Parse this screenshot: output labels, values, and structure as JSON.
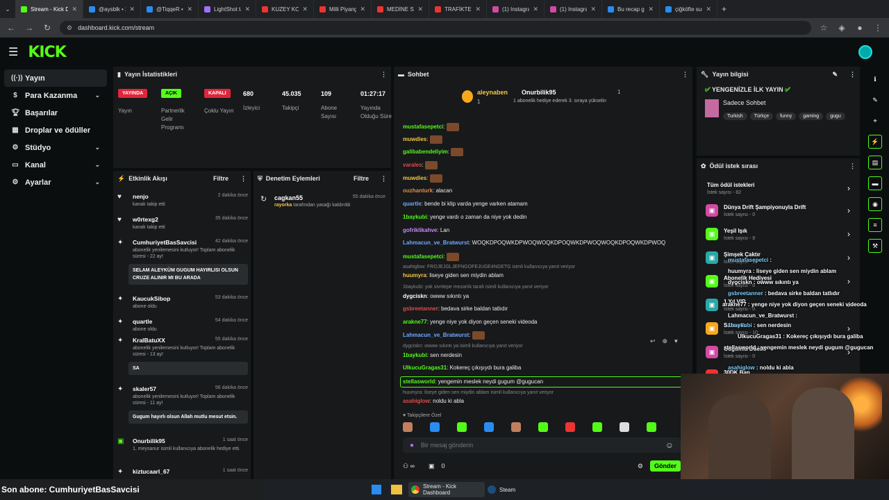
{
  "browser": {
    "tabs": [
      "Stream - Kick D",
      "@aysblk • 20",
      "@TiqqeR • 20",
      "LightShot tara",
      "KUZEY KORE'Y",
      "Milli Piyango",
      "MEDİNE SAYA",
      "TRAFİKTE TEH",
      "(1) Instagram",
      "(1) Instagram",
      "Bu recap gizli",
      "çiğköfte sushi"
    ],
    "url": "dashboard.kick.com/stream"
  },
  "header": {
    "logo": "KICK"
  },
  "sidebar": {
    "items": [
      "Yayın",
      "Para Kazanma",
      "Başarılar",
      "Droplar ve ödüller",
      "Stüdyo",
      "Kanal",
      "Ayarlar"
    ]
  },
  "stats": {
    "title": "Yayın İstatistikleri",
    "badges": [
      {
        "badge": "YAYINDA",
        "label": "Yayın"
      },
      {
        "badge": "AÇIK",
        "label": "Partnerlik Gelir Programı"
      },
      {
        "badge": "KAPALI",
        "label": "Çoklu Yayın"
      }
    ],
    "numbers": [
      {
        "value": "680",
        "label": "İzleyici"
      },
      {
        "value": "45.035",
        "label": "Takipçi"
      },
      {
        "value": "109",
        "label": "Abone Sayısı"
      },
      {
        "value": "01:27:17",
        "label": "Yayında Olduğu Süre"
      }
    ]
  },
  "activity": {
    "title": "Etkinlik Akışı",
    "filter": "Filtre",
    "items": [
      {
        "name": "nenjo",
        "time": "2 dakika önce",
        "sub": "kanalı takip etti"
      },
      {
        "name": "w0rtexg2",
        "time": "35 dakika önce",
        "sub": "kanalı takip etti"
      },
      {
        "name": "CumhuriyetBasSavcisi",
        "time": "42 dakika önce",
        "sub": "abonelik yenilemesini kutluyor! Toplam abonelik süresi - 22 ay!",
        "msg": "SELAM ALEYKÜM GUGUM HAYIRLISI OLSUN CRUZE ALINIR MI BU ARADA"
      },
      {
        "name": "KaucukSibop",
        "time": "53 dakika önce",
        "sub": "abone oldu"
      },
      {
        "name": "quartle",
        "time": "54 dakika önce",
        "sub": "abone oldu"
      },
      {
        "name": "KralBatuXX",
        "time": "55 dakika önce",
        "sub": "abonelik yenilemesini kutluyor! Toplam abonelik süresi - 13 ay!",
        "msg": "SA"
      },
      {
        "name": "skaler57",
        "time": "56 dakika önce",
        "sub": "abonelik yenilemesini kutluyor! Toplam abonelik süresi - 11 ay!",
        "msg": "Gugum hayırlı olsun Allah mutlu mesut etsin."
      },
      {
        "name": "Onurbilik95",
        "time": "1 saat önce",
        "sub": "1, meysanur isimli kullanıcıya abonelik hediye etti."
      },
      {
        "name": "kiztucaarl_67",
        "time": "1 saat önce",
        "sub": ""
      }
    ]
  },
  "moderation": {
    "title": "Denetim Eylemleri",
    "filter": "Filtre",
    "item": {
      "name": "cagkan55",
      "time": "55 dakika önce",
      "by": "rayorka",
      "text": "tarafından yasağı kaldırıldı"
    }
  },
  "chat": {
    "title": "Sohbet",
    "pinned": {
      "user1": "aleynaben",
      "count1": "1",
      "user2": "Onurbilik95",
      "count2": "1",
      "desc": "1 abonelik hediye ederek 3. sıraya yükselin"
    },
    "lines": [
      {
        "user": "mustafasepetci",
        "color": "#53fc18",
        "text": "",
        "emote": true
      },
      {
        "user": "muwdies",
        "color": "#f6c744",
        "text": "",
        "emote": true
      },
      {
        "user": "galibabendeliyim",
        "color": "#53fc18",
        "text": "",
        "emote": true
      },
      {
        "user": "varales",
        "color": "#e24a4a",
        "text": "",
        "emote": true
      },
      {
        "user": "muwdies",
        "color": "#f6c744",
        "text": "",
        "emote": true
      },
      {
        "user": "ouzhanturk",
        "color": "#e28a4a",
        "text": "alacan"
      },
      {
        "user": "quartle",
        "color": "#6fa8ff",
        "text": "bende bi klip varda yenge varken atamam"
      },
      {
        "user": "1baykubi",
        "color": "#53fc18",
        "text": "yenge vardı o zaman da niye yok dedin"
      },
      {
        "user": "gofriklikahve",
        "color": "#c58aff",
        "text": "Lan"
      },
      {
        "user": "Lahmacun_ve_Bratwurst",
        "color": "#6fa8ff",
        "text": "WOQKDPOQWKDPWOQWOQKDPOQWKDPWOQWOQKDPOQWKDPWOQ"
      },
      {
        "user": "mustafasepetci",
        "color": "#53fc18",
        "text": "",
        "emote": true
      }
    ],
    "reply1": "asahiglow: FROJEJGLJEFNGOFEJUGE4NGETG isimli kullanıcıya yanıt veriyor",
    "lines2": [
      {
        "user": "huumyra",
        "color": "#f6c744",
        "text": "liseye giden sen miydin ablam"
      }
    ],
    "reply2": "1baykubi: yok sivritepe mezarlık tarafı isimli kullanıcıya yanıt veriyor",
    "lines3": [
      {
        "user": "dygciskn",
        "color": "#fff",
        "text": "owww sıkıntı ya"
      },
      {
        "user": "gsbreetanner",
        "color": "#e24a4a",
        "text": "bedava sirke baldan tatlıdır"
      },
      {
        "user": "arakne77",
        "color": "#53fc18",
        "text": "yenge niye yok diyon geçen seneki videoda"
      },
      {
        "user": "Lahmacun_ve_Bratwurst",
        "color": "#6fa8ff",
        "text": "",
        "emote": true
      }
    ],
    "reply3": "dygciskn: owww sıkıntı ya isimli kullanıcıya yanıt veriyor",
    "lines4": [
      {
        "user": "1baykubi",
        "color": "#53fc18",
        "text": "sen nerdesin"
      },
      {
        "user": "UlkucuGragas31",
        "color": "#53fc18",
        "text": "Kokereç çıkışıydı bura galiba"
      },
      {
        "user": "stellasworld",
        "color": "#53fc18",
        "text": "yengemin meslek neydi gugum @gugucan"
      }
    ],
    "reply4": "huumyra: liseye giden sen miydin ablam isimli kullanıcıya yanıt veriyor",
    "lines5": [
      {
        "user": "asahiglow",
        "color": "#e24a4a",
        "text": "noldu ki abla"
      }
    ],
    "followers_only": "Takipçilere Özel",
    "placeholder": "Bir mesaj gönderin",
    "count": "0",
    "send": "Gönder"
  },
  "stream_info": {
    "title": "Yayın bilgisi",
    "stream_title": "YENGENİZLE İLK YAYIN",
    "category": "Sadece Sohbet",
    "tags": [
      "Turkish",
      "Türkçe",
      "funny",
      "gaming",
      "gugu"
    ]
  },
  "rewards": {
    "title": "Ödül istek sırası",
    "items": [
      {
        "title": "Tüm ödül istekleri",
        "sub": "İstek sayısı - 82"
      },
      {
        "title": "Dünya Drift Şampiyonuyla Drift",
        "sub": "İstek sayısı - 0"
      },
      {
        "title": "Yeşil Işık",
        "sub": "İstek sayısı - 9"
      },
      {
        "title": "Şimşek Çaktır",
        "sub": "İstek sayısı - 16"
      },
      {
        "title": "Abonelik Hediyesi",
        "sub": "İstek sayısı - 0"
      },
      {
        "title": "1 Yıl VIP",
        "sub": "İstek sayısı - 0"
      },
      {
        "title": "Sahnede",
        "sub": "İstek sayısı - 10"
      },
      {
        "title": "Gugumla Düello",
        "sub": "İstek sayısı - 0"
      },
      {
        "title": "30DK Ban",
        "sub": ""
      }
    ]
  },
  "overlay_chat": [
    {
      "user": "mustafasepetci",
      "text": ""
    },
    {
      "user": "huumyra",
      "text": "liseye giden sen miydin ablam"
    },
    {
      "user": "dygciskn",
      "text": "owww sıkıntı ya"
    },
    {
      "user": "gsbreetanner",
      "text": "bedava sirke baldan tatlıdır"
    },
    {
      "user": "arakne77",
      "text": "yenge niye yok diyon geçen seneki videoda"
    },
    {
      "user": "Lahmacun_ve_Bratwurst",
      "text": ""
    },
    {
      "user": "1baykubi",
      "text": "sen nerdesin"
    },
    {
      "user": "UlkucuGragas31",
      "text": "Kokereç çıkışıydı bura galiba"
    },
    {
      "user": "stellasworld",
      "text": "yengemin meslek neydi gugum @gugucan"
    },
    {
      "user": "asahiglow",
      "text": "noldu ki abla"
    }
  ],
  "last_sub": "Son abone: CumhuriyetBasSavcisi",
  "taskbar": {
    "apps": [
      "Stream - Kick Dashboard",
      "Steam"
    ]
  }
}
